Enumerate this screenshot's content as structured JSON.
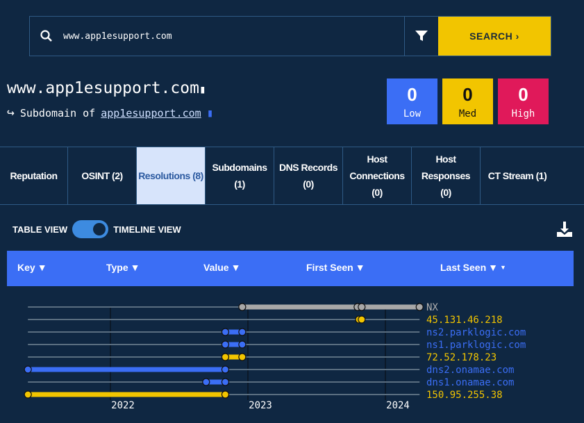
{
  "search": {
    "value": "www.app1esupport.com",
    "button_label": "SEARCH"
  },
  "header": {
    "title": "www.app1esupport.com",
    "subdomain_prefix": "Subdomain of",
    "parent_domain": "app1esupport.com"
  },
  "scores": [
    {
      "value": "0",
      "label": "Low",
      "color": "#3b6ef5"
    },
    {
      "value": "0",
      "label": "Med",
      "color": "#f2c500"
    },
    {
      "value": "0",
      "label": "High",
      "color": "#e0195a"
    }
  ],
  "tabs": [
    {
      "label": "Reputation"
    },
    {
      "label": "OSINT (2)"
    },
    {
      "label": "Resolutions (8)",
      "active": true
    },
    {
      "label": "Subdomains (1)"
    },
    {
      "label": "DNS Records (0)"
    },
    {
      "label": "Host Connections (0)"
    },
    {
      "label": "Host Responses (0)"
    },
    {
      "label": "CT Stream (1)"
    }
  ],
  "view": {
    "left_label": "TABLE VIEW",
    "right_label": "TIMELINE VIEW",
    "timeline_on": true
  },
  "table": {
    "columns": [
      "Key",
      "Type",
      "Value",
      "First Seen",
      "Last Seen"
    ]
  },
  "chart_data": {
    "type": "timeline",
    "x_ticks": [
      "2022",
      "2023",
      "2024"
    ],
    "xlim": [
      "2021-05-27",
      "2024-04-01"
    ],
    "rows": [
      {
        "label": "NX",
        "color": "#a8a8a8",
        "points": [
          "2022-12-17",
          "2023-10-19",
          "2023-10-30",
          "2024-04-01"
        ]
      },
      {
        "label": "45.131.46.218",
        "color": "#f2c500",
        "points": [
          "2023-10-23",
          "2023-10-30"
        ]
      },
      {
        "label": "ns2.parklogic.com",
        "color": "#3b6ef5",
        "points": [
          "2022-11-02",
          "2022-12-17"
        ]
      },
      {
        "label": "ns1.parklogic.com",
        "color": "#3b6ef5",
        "points": [
          "2022-11-02",
          "2022-12-17"
        ]
      },
      {
        "label": "72.52.178.23",
        "color": "#f2c500",
        "points": [
          "2022-11-02",
          "2022-12-17"
        ]
      },
      {
        "label": "dns2.onamae.com",
        "color": "#3b6ef5",
        "points": [
          "2021-05-27",
          "2022-11-02"
        ]
      },
      {
        "label": "dns1.onamae.com",
        "color": "#3b6ef5",
        "points": [
          "2022-09-12",
          "2022-11-02"
        ]
      },
      {
        "label": "150.95.255.38",
        "color": "#f2c500",
        "points": [
          "2021-05-27",
          "2022-11-02"
        ]
      }
    ]
  }
}
